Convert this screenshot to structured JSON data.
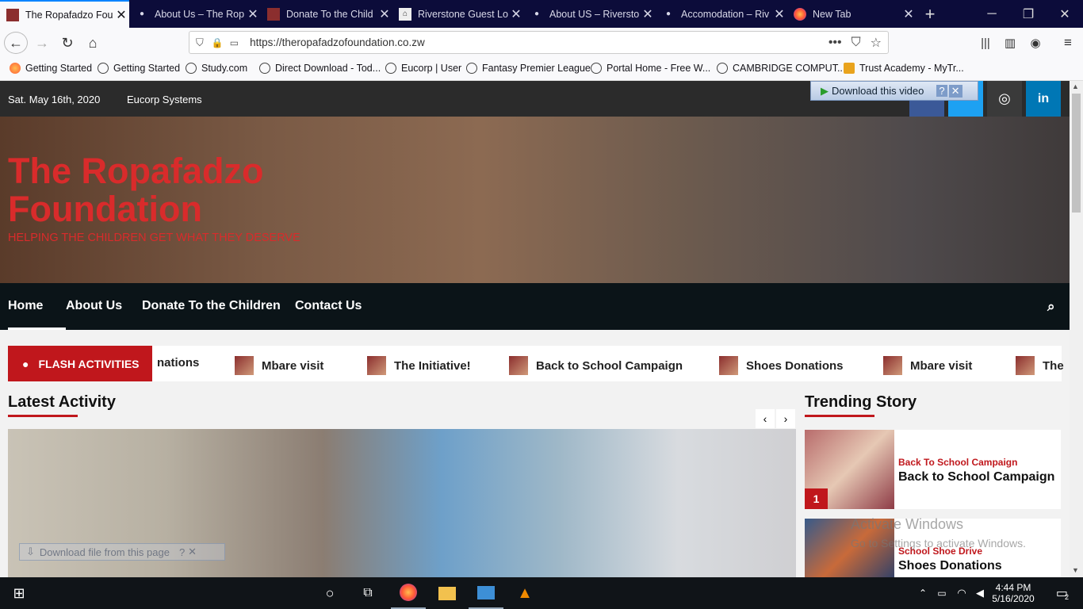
{
  "tabs": [
    {
      "title": "The Ropafadzo Fou",
      "active": true
    },
    {
      "title": "About Us – The Rop"
    },
    {
      "title": "Donate To the Child"
    },
    {
      "title": "Riverstone Guest Lo"
    },
    {
      "title": "About US – Riversto"
    },
    {
      "title": "Accomodation – Riv"
    },
    {
      "title": "New Tab"
    }
  ],
  "url": "https://theropafadzofoundation.co.zw",
  "bookmarks": [
    "Getting Started",
    "Getting Started",
    "Study.com",
    "Direct Download - Tod...",
    "Eucorp | User",
    "Fantasy Premier League",
    "Portal Home - Free W...",
    "CAMBRIDGE COMPUT...",
    "Trust Academy - MyTr..."
  ],
  "site": {
    "date": "Sat. May 16th, 2020",
    "company": "Eucorp Systems",
    "download_video": "Download this video",
    "title_line1": "The Ropafadzo",
    "title_line2": "Foundation",
    "tagline": "HELPING THE CHILDREN GET WHAT THEY DESERVE",
    "nav": [
      "Home",
      "About Us",
      "Donate To the Children",
      "Contact Us"
    ],
    "flash_label": "FLASH ACTIVITIES",
    "flash_items": [
      "nations",
      "Mbare visit",
      "The Initiative!",
      "Back to School Campaign",
      "Shoes Donations",
      "Mbare visit",
      "The"
    ],
    "latest_heading": "Latest Activity",
    "trending_heading": "Trending Story",
    "download_file": "Download file from this page",
    "trending": [
      {
        "category": "Back To School Campaign",
        "title": "Back to School Campaign",
        "rank": "1"
      },
      {
        "category": "School Shoe Drive",
        "title": "Shoes Donations"
      }
    ],
    "watermark_line1": "Activate Windows",
    "watermark_line2": "Go to Settings to activate Windows."
  },
  "taskbar": {
    "time": "4:44 PM",
    "date": "5/16/2020",
    "notif_count": "2"
  },
  "colors": {
    "accent_red": "#c0171c",
    "title_red": "#d92b2b",
    "nav_bg": "#0b1418",
    "tab_bg": "#0c0c3a"
  }
}
